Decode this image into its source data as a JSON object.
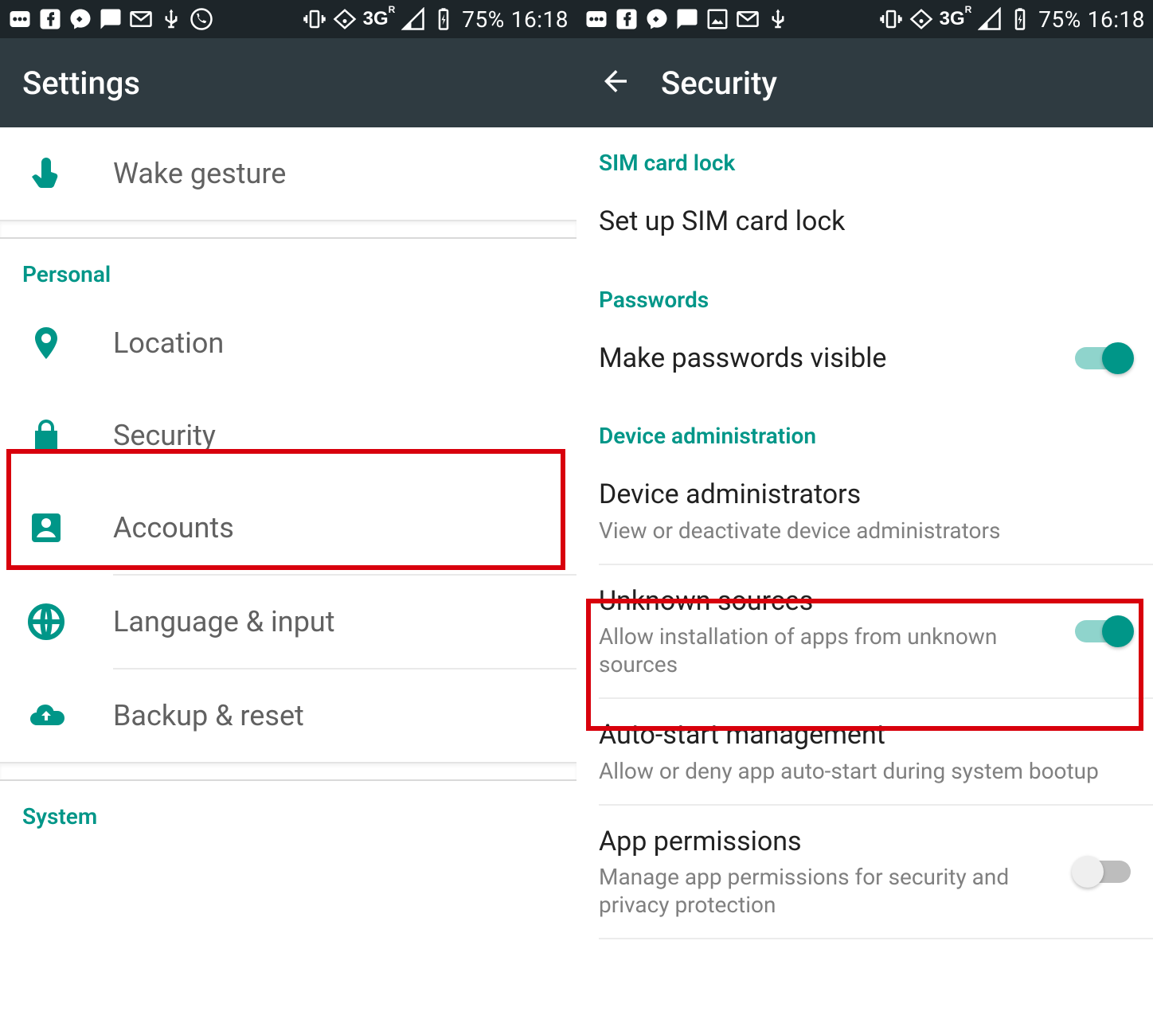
{
  "statusbar": {
    "network_label": "3G",
    "network_suffix": "R",
    "battery_percent": "75%",
    "clock": "16:18"
  },
  "left": {
    "appbar_title": "Settings",
    "items": {
      "wake_gesture": "Wake gesture",
      "location": "Location",
      "security": "Security",
      "accounts": "Accounts",
      "language_input": "Language & input",
      "backup_reset": "Backup & reset"
    },
    "section_personal": "Personal",
    "section_system": "System"
  },
  "right": {
    "appbar_title": "Security",
    "sections": {
      "sim_card_lock": "SIM card lock",
      "passwords": "Passwords",
      "device_admin": "Device administration"
    },
    "items": {
      "set_up_sim": {
        "title": "Set up SIM card lock"
      },
      "make_pw_visible": {
        "title": "Make passwords visible"
      },
      "device_admins": {
        "title": "Device administrators",
        "subtitle": "View or deactivate device administrators"
      },
      "unknown_sources": {
        "title": "Unknown sources",
        "subtitle": "Allow installation of apps from unknown sources"
      },
      "auto_start": {
        "title": "Auto-start management",
        "subtitle": "Allow or deny app auto-start during system bootup"
      },
      "app_permissions": {
        "title": "App permissions",
        "subtitle": "Manage app permissions for security and privacy protection"
      }
    }
  }
}
